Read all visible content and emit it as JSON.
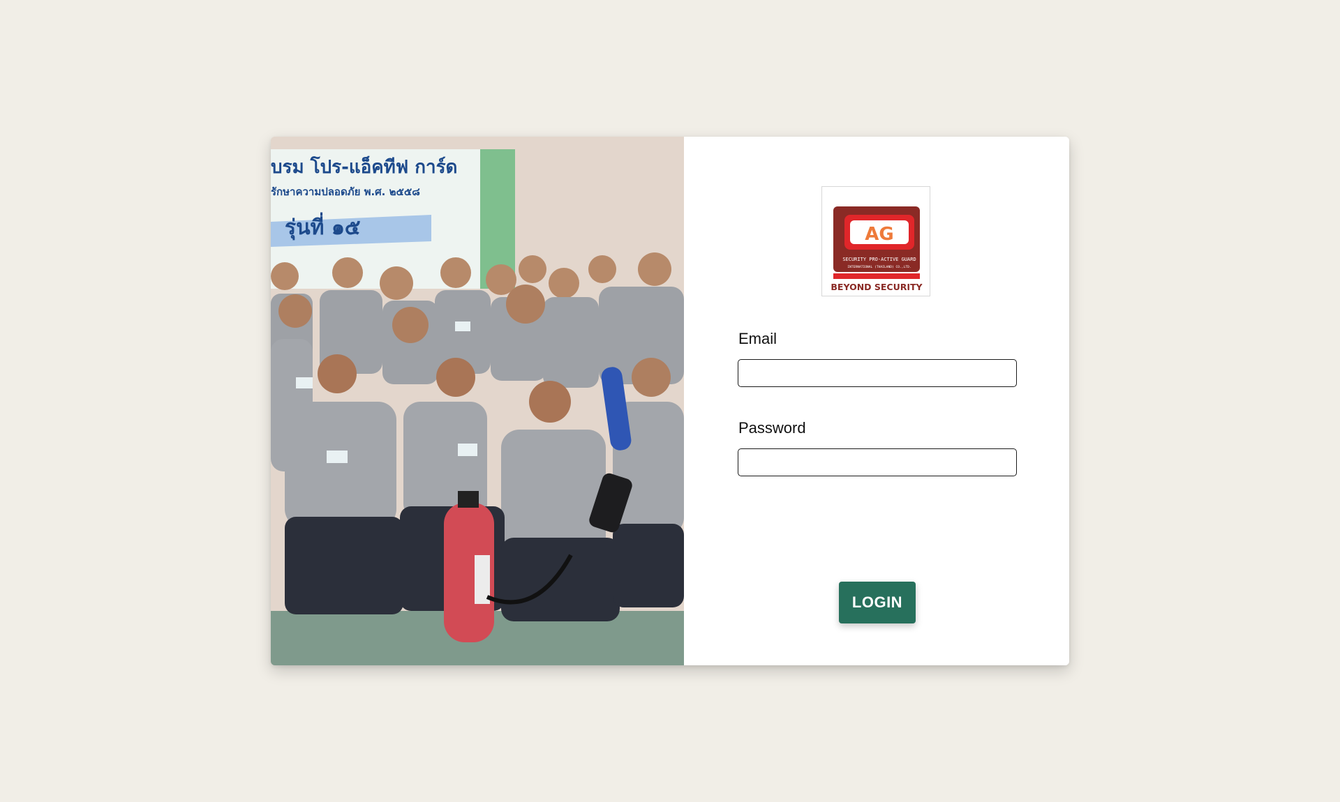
{
  "photo": {
    "banner_line1": "บรม โปร-แอ็คทีฟ การ์ด",
    "banner_line2": "รักษาความปลอดภัย พ.ศ. ๒๕๕๘",
    "banner_line3": "รุ่นที่ ๑๕"
  },
  "logo": {
    "letters": "AG",
    "company_line1": "SECURITY PRO-ACTIVE GUARD",
    "company_line2": "INTERNATIONAL (THAILAND) CO.,LTD.",
    "tagline": "BEYOND SECURITY",
    "colors": {
      "maroon": "#8a2a25",
      "red": "#e0262a"
    }
  },
  "form": {
    "email_label": "Email",
    "email_value": "",
    "password_label": "Password",
    "password_value": "",
    "login_label": "LOGIN"
  },
  "colors": {
    "background": "#f1eee7",
    "button": "#27705c"
  }
}
